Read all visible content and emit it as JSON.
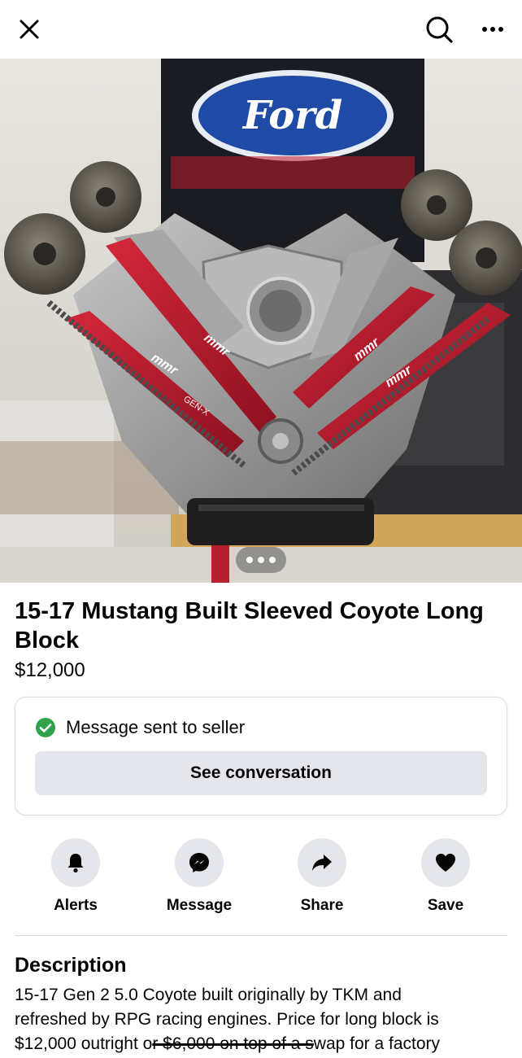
{
  "header": {
    "close_icon": "close-icon",
    "search_icon": "search-icon",
    "more_icon": "more-icon"
  },
  "photo": {
    "banner_brand": "Ford",
    "plate_text": "mmr",
    "plate_text_alt": "GEN-X",
    "pager": {
      "count": 3,
      "active": 1
    }
  },
  "listing": {
    "title": "15-17 Mustang Built Sleeved Coyote Long Block",
    "price": "$12,000"
  },
  "status_card": {
    "message": "Message sent to seller",
    "button_label": "See conversation",
    "check_color": "#31a24c"
  },
  "actions": [
    {
      "label": "Alerts",
      "icon": "bell-icon"
    },
    {
      "label": "Message",
      "icon": "messenger-icon"
    },
    {
      "label": "Share",
      "icon": "share-arrow-icon"
    },
    {
      "label": "Save",
      "icon": "heart-icon"
    }
  ],
  "description": {
    "heading": "Description",
    "line1": "15-17 Gen 2 5.0 Coyote built originally by TKM and",
    "line2": "refreshed by RPG racing engines. Price for long block is",
    "line3_a": "$12,000 outright o",
    "line3_strike": "r $6,000 on top of a s",
    "line3_b": "wap for a factory"
  }
}
